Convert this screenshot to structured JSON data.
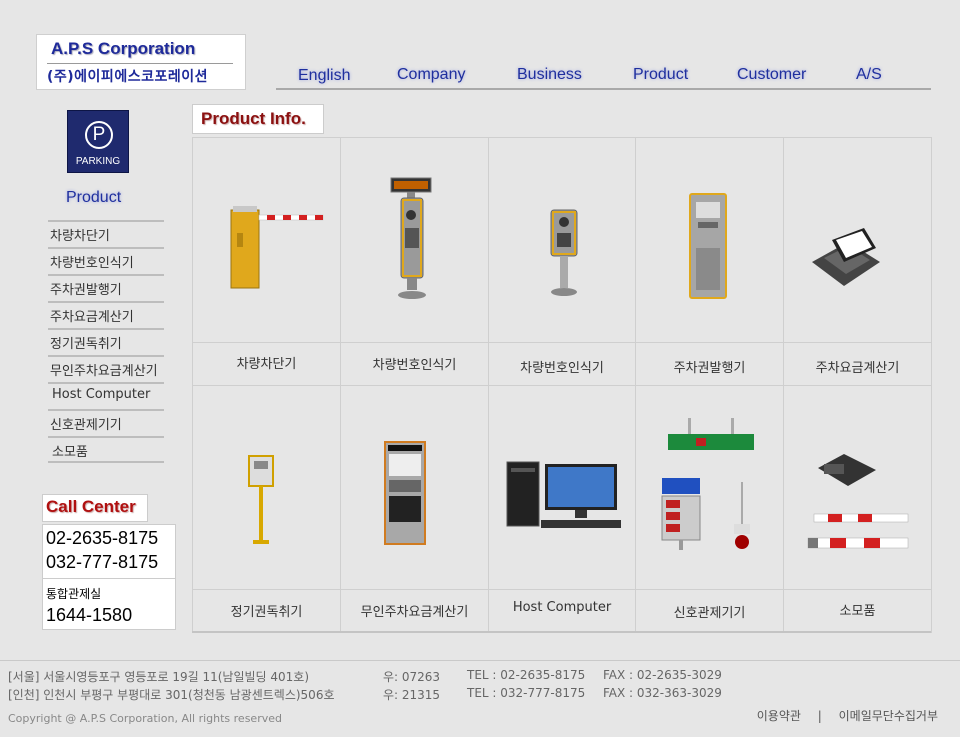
{
  "logo": {
    "en": "A.P.S Corporation",
    "kr": "(주)에이피에스코포레이션"
  },
  "nav": [
    "English",
    "Company",
    "Business",
    "Product",
    "Customer",
    "A/S"
  ],
  "sidebar": {
    "badge_letter": "P",
    "badge_text": "PARKING",
    "title": "Product",
    "items": [
      "차량차단기",
      "차량번호인식기",
      "주차권발행기",
      "주차요금계산기",
      "정기권독취기",
      "무인주차요금계산기",
      "Host Computer",
      "신호관제기기",
      "소모품"
    ]
  },
  "call_center": {
    "title": "Call Center",
    "phone1": "02-2635-8175",
    "phone2": "032-777-8175",
    "hub_label": "통합관제실",
    "hub_phone": "1644-1580"
  },
  "main": {
    "title": "Product Info.",
    "products": [
      {
        "label": "차량차단기",
        "icon": "barrier-gate-icon"
      },
      {
        "label": "차량번호인식기",
        "icon": "plate-recognition-camera-icon"
      },
      {
        "label": "차량번호인식기",
        "icon": "plate-recognition-unit-icon"
      },
      {
        "label": "주차권발행기",
        "icon": "ticket-dispenser-icon"
      },
      {
        "label": "주차요금계산기",
        "icon": "fee-computer-icon"
      },
      {
        "label": "정기권독취기",
        "icon": "pass-reader-icon"
      },
      {
        "label": "무인주차요금계산기",
        "icon": "unmanned-kiosk-icon"
      },
      {
        "label": "Host Computer",
        "icon": "host-computer-icon"
      },
      {
        "label": "신호관제기기",
        "icon": "signal-control-icon"
      },
      {
        "label": "소모품",
        "icon": "consumables-icon"
      }
    ]
  },
  "footer": {
    "seoul": {
      "address": "[서울] 서울시영등포구 영등포로 19길 11(남일빌딩 401호)",
      "zip": "우: 07263",
      "tel": "TEL : 02-2635-8175",
      "fax": "FAX : 02-2635-3029"
    },
    "incheon": {
      "address": "[인천] 인천시 부평구 부평대로 301(청천동 남광센트렉스)506호",
      "zip": "우: 21315",
      "tel": "TEL : 032-777-8175",
      "fax": "FAX : 032-363-3029"
    },
    "copyright": "Copyright @ A.P.S Corporation, All rights reserved",
    "links": [
      "이용약관",
      "이메일무단수집거부"
    ]
  },
  "colors": {
    "nav_blue": "#1f2f9e",
    "call_red": "#b01010",
    "badge_navy": "#1f2a6e"
  }
}
